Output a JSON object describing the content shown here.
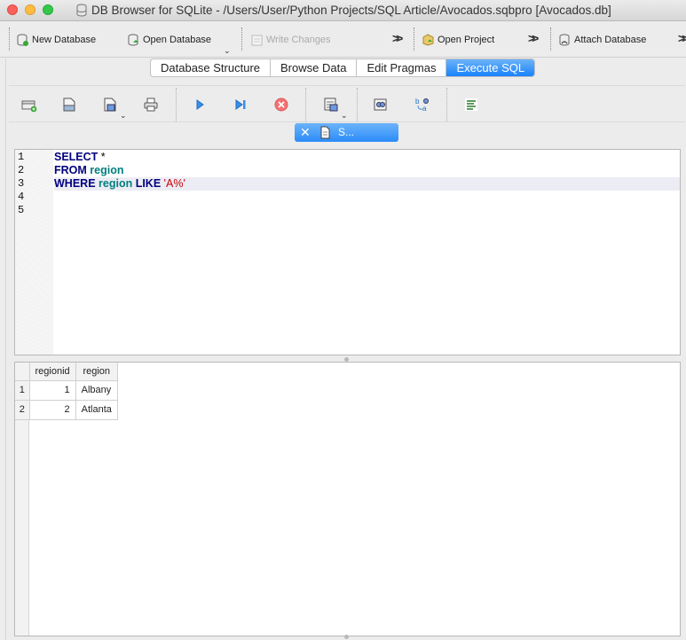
{
  "window": {
    "title": "DB Browser for SQLite - /Users/User/Python Projects/SQL Article/Avocados.sqbpro [Avocados.db]"
  },
  "main_toolbar": {
    "new_database": "New Database",
    "open_database": "Open Database",
    "write_changes": "Write Changes",
    "open_project": "Open Project",
    "attach_database": "Attach Database"
  },
  "tabs": [
    {
      "label": "Database Structure",
      "active": false
    },
    {
      "label": "Browse Data",
      "active": false
    },
    {
      "label": "Edit Pragmas",
      "active": false
    },
    {
      "label": "Execute SQL",
      "active": true
    }
  ],
  "sql_toolbar": {
    "icons": [
      "open-tab-icon",
      "open-sql-icon",
      "save-sql-icon",
      "print-icon",
      "execute-all-icon",
      "execute-line-icon",
      "stop-icon",
      "save-results-icon",
      "find-icon",
      "find-replace-icon",
      "comment-icon"
    ]
  },
  "file_tab": {
    "name": "S..."
  },
  "editor": {
    "line_numbers": [
      "1",
      "2",
      "3",
      "4",
      "5"
    ],
    "lines": [
      [
        {
          "t": "kw",
          "v": "SELECT"
        },
        {
          "t": "plain",
          "v": " *"
        }
      ],
      [
        {
          "t": "kw",
          "v": "FROM"
        },
        {
          "t": "plain",
          "v": " "
        },
        {
          "t": "id",
          "v": "region"
        }
      ],
      [
        {
          "t": "kw",
          "v": "WHERE"
        },
        {
          "t": "plain",
          "v": " "
        },
        {
          "t": "id",
          "v": "region"
        },
        {
          "t": "plain",
          "v": " "
        },
        {
          "t": "kw",
          "v": "LIKE"
        },
        {
          "t": "plain",
          "v": " "
        },
        {
          "t": "str",
          "v": "'A%'"
        }
      ],
      [],
      []
    ],
    "current_line": 3
  },
  "results": {
    "columns": [
      "regionid",
      "region"
    ],
    "rows": [
      {
        "rownum": "1",
        "regionid": "1",
        "region": "Albany"
      },
      {
        "rownum": "2",
        "regionid": "2",
        "region": "Atlanta"
      }
    ]
  },
  "colors": {
    "accent": "#1a82fb",
    "keyword": "#00007f",
    "identifier": "#007f7f",
    "string": "#cc0000"
  }
}
